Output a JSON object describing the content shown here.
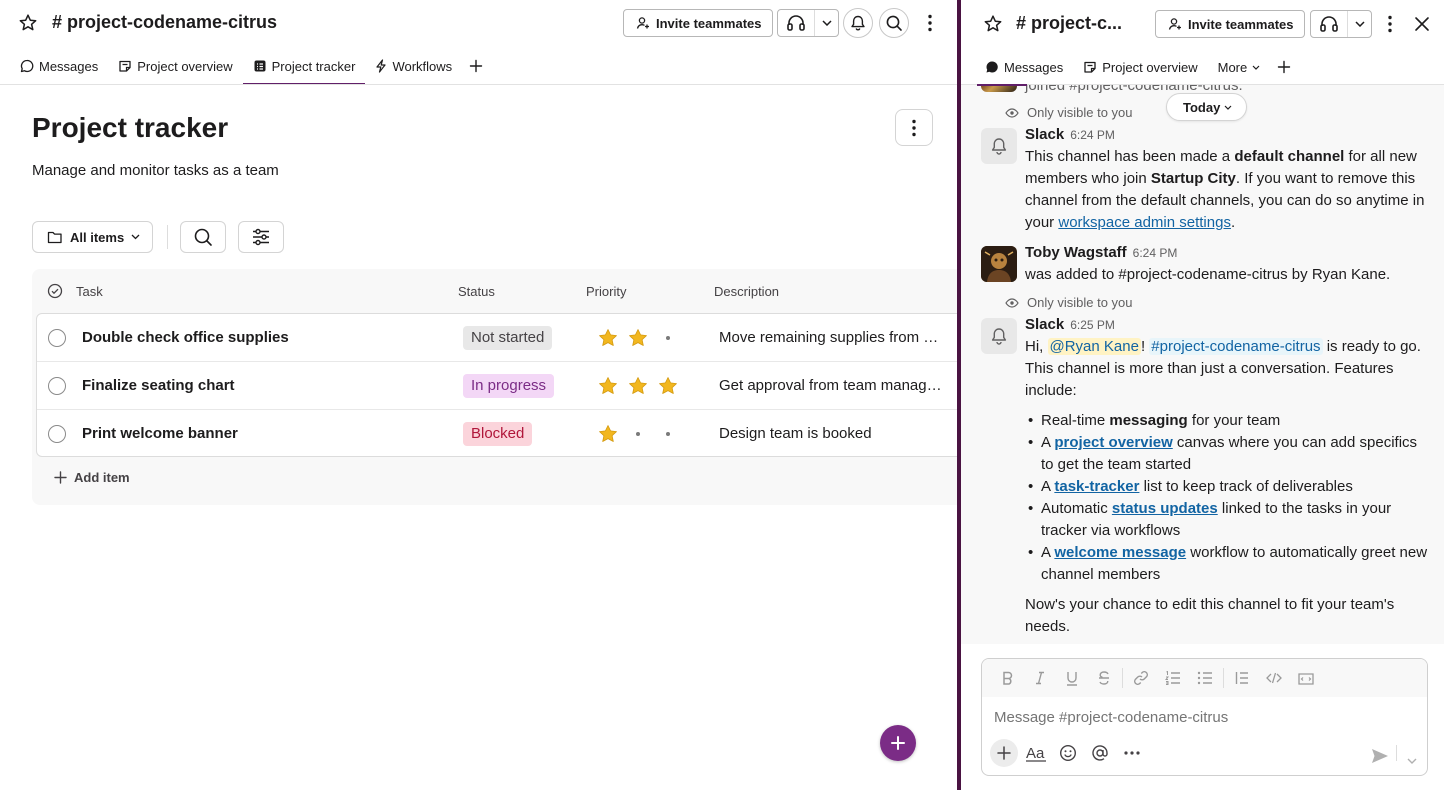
{
  "left": {
    "channel_title": "# project-codename-citrus",
    "invite_label": "Invite teammates",
    "tabs": [
      {
        "label": "Messages",
        "icon": "message-bubble-icon"
      },
      {
        "label": "Project overview",
        "icon": "canvas-icon"
      },
      {
        "label": "Project tracker",
        "icon": "list-icon",
        "active": true
      },
      {
        "label": "Workflows",
        "icon": "lightning-icon"
      }
    ],
    "page": {
      "title": "Project tracker",
      "description": "Manage and monitor tasks as a team"
    },
    "filter": {
      "label": "All items"
    },
    "table": {
      "headers": {
        "task": "Task",
        "status": "Status",
        "priority": "Priority",
        "description": "Description"
      },
      "rows": [
        {
          "task": "Double check office supplies",
          "status": "Not started",
          "status_color": "#e8e8e8",
          "priority": 2,
          "description": "Move remaining supplies from ol..."
        },
        {
          "task": "Finalize seating chart",
          "status": "In progress",
          "status_color": "#f3d7f6",
          "priority": 3,
          "description": "Get approval from team managers"
        },
        {
          "task": "Print welcome banner",
          "status": "Blocked",
          "status_color": "#fbd4db",
          "priority": 1,
          "description": "Design team is booked"
        }
      ],
      "add_item": "Add item"
    },
    "accent_color": "#611f69"
  },
  "right": {
    "channel_title": "# project-c...",
    "invite_label": "Invite teammates",
    "tabs": [
      {
        "label": "Messages",
        "active": true
      },
      {
        "label": "Project overview"
      },
      {
        "label": "More"
      }
    ],
    "today_label": "Today",
    "prior_snippet": "joined #project-codename-citrus.",
    "messages": [
      {
        "visibility": "Only visible to you",
        "sender": "Slack",
        "time": "6:24 PM",
        "text_parts": {
          "p1": "This channel has been made a ",
          "b1": "default channel",
          "p2": " for all new members who join ",
          "b2": "Startup City",
          "p3": ". If you want to remove this channel from the default channels, you can do so anytime in your ",
          "link": "workspace admin settings",
          "p4": "."
        }
      },
      {
        "sender": "Toby Wagstaff",
        "time": "6:24 PM",
        "text": "was added to #project-codename-citrus by Ryan Kane."
      },
      {
        "visibility": "Only visible to you",
        "sender": "Slack",
        "time": "6:25 PM",
        "greeting": "Hi, ",
        "mention": "@Ryan Kane",
        "exclaim": "! ",
        "channel_mention": "#project-codename-citrus",
        "intro": " is ready to go. This channel is more than just a conversation. Features include:",
        "bullets": [
          {
            "pre": "Real-time ",
            "bold": "messaging",
            "post": " for your team"
          },
          {
            "pre": "A ",
            "link": "project overview",
            "post": " canvas where you can add specifics to get the team started"
          },
          {
            "pre": "A ",
            "link": "task-tracker",
            "post": " list to keep track of deliverables"
          },
          {
            "pre": "Automatic ",
            "link": "status updates",
            "post": " linked to the tasks in your tracker via workflows"
          },
          {
            "pre": "A ",
            "link": "welcome message",
            "post": " workflow to automatically greet new channel members"
          }
        ],
        "closing": "Now's your chance to edit this channel to fit your team's needs."
      }
    ],
    "composer": {
      "placeholder": "Message #project-codename-citrus"
    }
  }
}
